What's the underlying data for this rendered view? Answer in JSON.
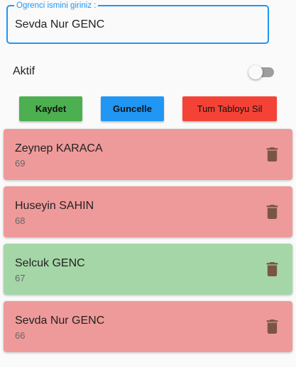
{
  "form": {
    "label": "Ogrenci ismini giriniz :",
    "value": "Sevda Nur GENC",
    "accent_color": "#2196f3"
  },
  "toggle": {
    "label": "Aktif",
    "checked": false
  },
  "buttons": {
    "save": "Kaydet",
    "update": "Guncelle",
    "clear": "Tum Tabloyu Sil"
  },
  "colors": {
    "active_card": "#a5d6a7",
    "inactive_card": "#ef9a9a",
    "delete_icon": "#795548"
  },
  "students": [
    {
      "name": "Zeynep KARACA",
      "score": "69",
      "active": false
    },
    {
      "name": "Huseyin SAHIN",
      "score": "68",
      "active": false
    },
    {
      "name": "Selcuk GENC",
      "score": "67",
      "active": true
    },
    {
      "name": "Sevda Nur GENC",
      "score": "66",
      "active": false
    }
  ]
}
